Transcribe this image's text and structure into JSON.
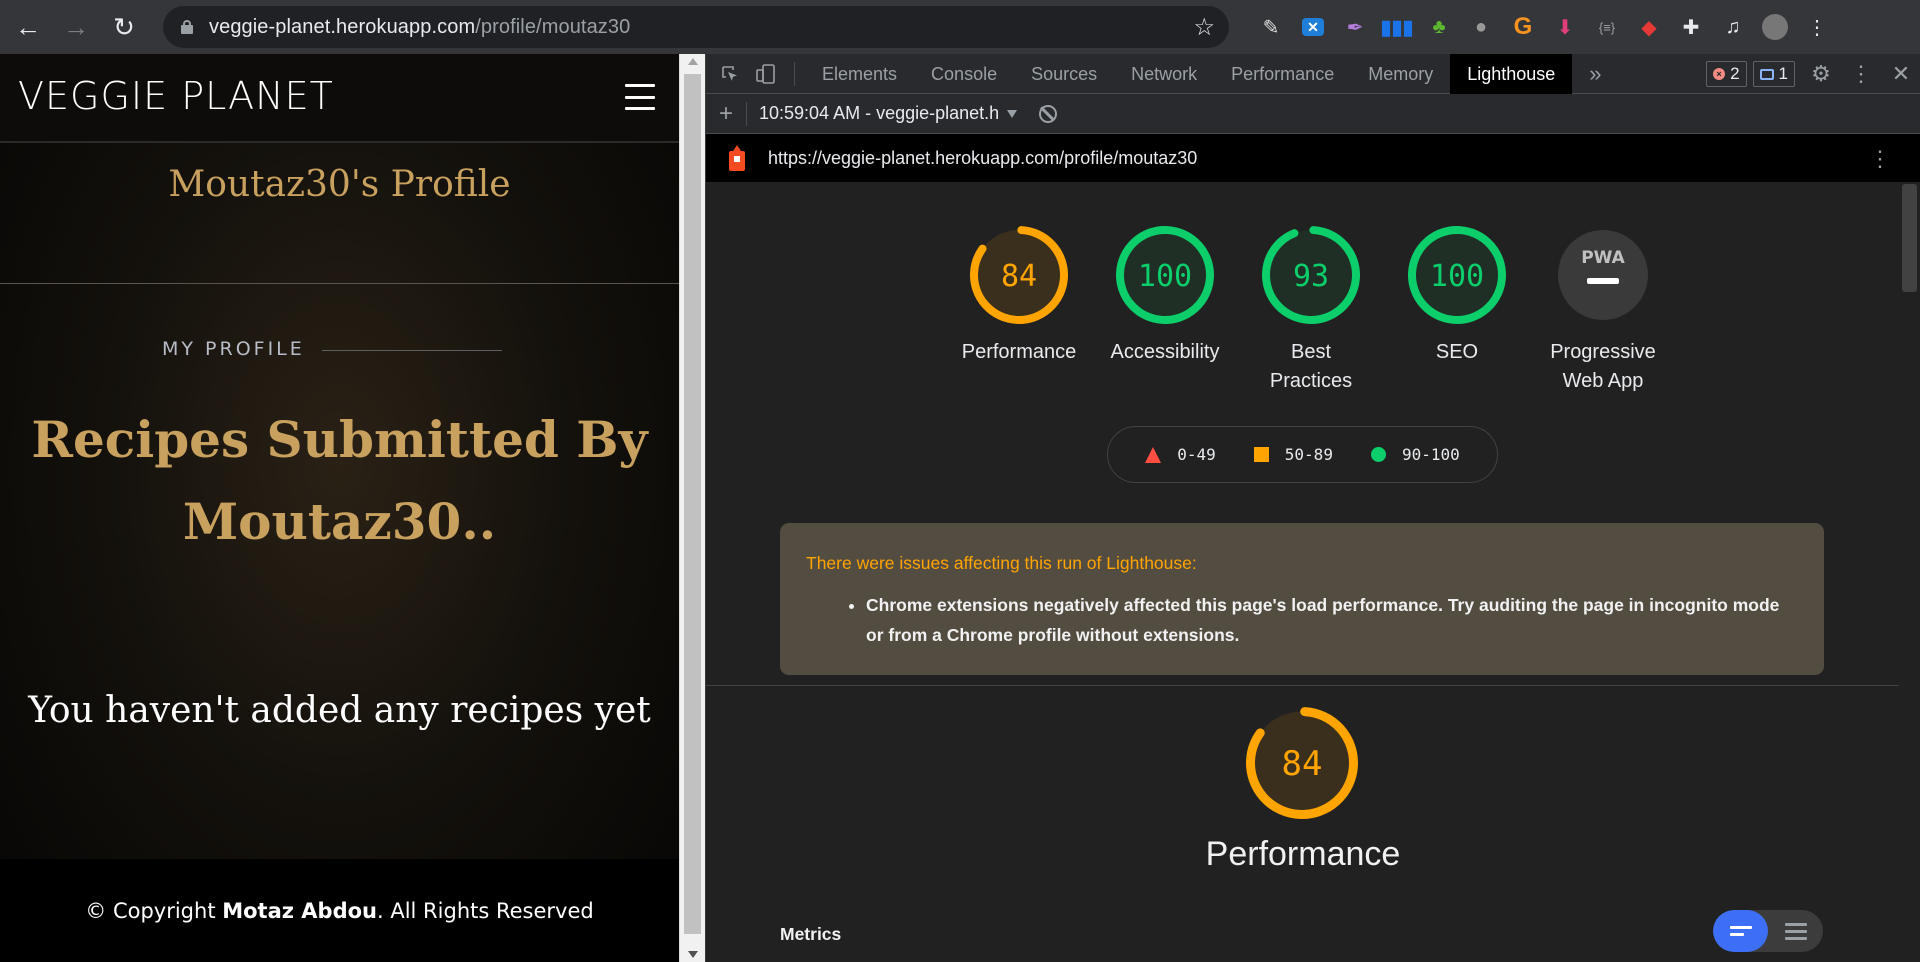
{
  "browser": {
    "url_host": "veggie-planet.herokuapp.com",
    "url_path": "/profile/moutaz30",
    "nav": {
      "back": "back-icon",
      "forward": "forward-icon",
      "reload": "reload-icon"
    },
    "extensions": [
      "eyedropper-icon",
      "vscode-ext-icon",
      "feather-ext-icon",
      "bars-ext-icon",
      "html-tree-ext-icon",
      "bug-ext-icon",
      "g-ext-icon",
      "pink-ext-icon",
      "json-ext-icon",
      "red-ext-icon",
      "puzzle-icon",
      "playlist-icon",
      "avatar",
      "kebab-icon"
    ],
    "json_ext_label": "{≡}"
  },
  "site": {
    "brand": "VEGGIE PLANET",
    "profile_title": "Moutaz30's Profile",
    "section_label": "MY PROFILE",
    "recipes_heading_line1": "Recipes Submitted By",
    "recipes_heading_line2": "Moutaz30..",
    "empty_message": "You haven't added any recipes yet",
    "footer_prefix": "© Copyright ",
    "footer_name": "Motaz Abdou",
    "footer_suffix": ". All Rights Reserved"
  },
  "devtools": {
    "tabs": [
      {
        "label": "Elements",
        "active": false
      },
      {
        "label": "Console",
        "active": false
      },
      {
        "label": "Sources",
        "active": false
      },
      {
        "label": "Network",
        "active": false
      },
      {
        "label": "Performance",
        "active": false
      },
      {
        "label": "Memory",
        "active": false
      },
      {
        "label": "Lighthouse",
        "active": true
      }
    ],
    "more_tabs": "»",
    "error_count": "2",
    "message_count": "1",
    "lighthouse": {
      "run_label": "10:59:04 AM - veggie-planet.h",
      "report_url": "https://veggie-planet.herokuapp.com/profile/moutaz30",
      "scores": [
        {
          "label": "Performance",
          "value": 84,
          "color": "#ffa400",
          "bg": "#3a2f1d"
        },
        {
          "label": "Accessibility",
          "value": 100,
          "color": "#0cce6b",
          "bg": "#1f2f25"
        },
        {
          "label": "Best Practices",
          "value": 93,
          "color": "#0cce6b",
          "bg": "#1f2f25"
        },
        {
          "label": "SEO",
          "value": 100,
          "color": "#0cce6b",
          "bg": "#1f2f25"
        },
        {
          "label": "Progressive Web App",
          "value": null,
          "badge": "PWA",
          "color": "#9aa0a6",
          "bg": "#3a3a3a"
        }
      ],
      "legend": [
        {
          "symbol": "triangle",
          "range": "0-49",
          "color": "#ff4e42"
        },
        {
          "symbol": "square",
          "range": "50-89",
          "color": "#ffa400"
        },
        {
          "symbol": "circle",
          "range": "90-100",
          "color": "#0cce6b"
        }
      ],
      "warning_title": "There were issues affecting this run of Lighthouse:",
      "warning_items": [
        "Chrome extensions negatively affected this page's load performance. Try auditing the page in incognito mode or from a Chrome profile without extensions."
      ],
      "performance": {
        "score": 84,
        "title": "Performance",
        "metrics_label": "Metrics"
      }
    }
  }
}
